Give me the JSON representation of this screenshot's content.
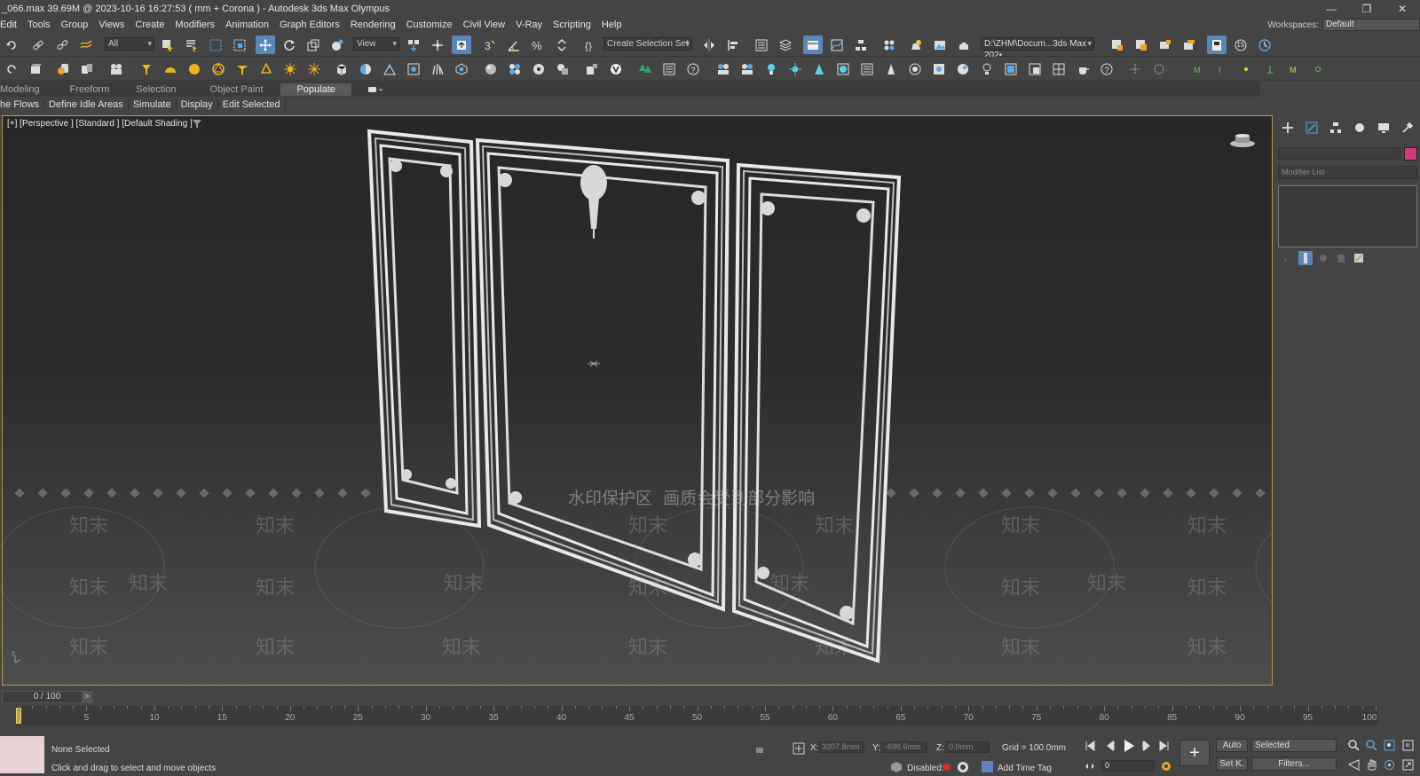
{
  "titlebar": {
    "title": "_066.max  39.69M @ 2023-10-16 16:27:53  ( mm + Corona ) - Autodesk 3ds Max Olympus",
    "minimize": "—",
    "restore": "❐",
    "close": "✕"
  },
  "menu": [
    "Edit",
    "Tools",
    "Group",
    "Views",
    "Create",
    "Modifiers",
    "Animation",
    "Graph Editors",
    "Rendering",
    "Customize",
    "Civil View",
    "V-Ray",
    "Scripting",
    "Help"
  ],
  "workspaces": {
    "label": "Workspaces:",
    "value": "Default"
  },
  "toolbar1": {
    "filter": "All",
    "refcoord": "View",
    "selection_set": "Create Selection Set",
    "project_path": "D:\\ZHM\\Docum...3ds Max 202•",
    "badge": "15"
  },
  "ribbon": {
    "tabs": [
      "Modeling",
      "Freeform",
      "Selection",
      "Object Paint",
      "Populate"
    ],
    "active_tab": "Populate",
    "sub": [
      "he Flows",
      "Define Idle Areas",
      "Simulate",
      "Display",
      "Edit Selected"
    ]
  },
  "viewport": {
    "label": "[+] [Perspective ] [Standard ] [Default Shading ]",
    "watermark_banner": "水印保护区  画质会受到部分影响",
    "watermark_text": "知末"
  },
  "command_panel": {
    "modifier_list": "Modifier List",
    "object_color": "#d23a7d"
  },
  "timeline": {
    "frame_display": "0 / 100",
    "ticks": [
      "5",
      "10",
      "15",
      "20",
      "25",
      "30",
      "35",
      "40",
      "45",
      "50",
      "55",
      "60",
      "65",
      "70",
      "75",
      "80",
      "85",
      "90",
      "95",
      "100"
    ]
  },
  "status": {
    "selection": "None Selected",
    "prompt": "Click and drag to select and move objects",
    "x_label": "X:",
    "x_value": "3207.8mm",
    "y_label": "Y:",
    "y_value": "-696.6mm",
    "z_label": "Z:",
    "z_value": "0.0mm",
    "grid": "Grid = 100.0mm",
    "disabled": "Disabled:",
    "add_time_tag": "Add Time Tag",
    "auto": "Auto",
    "selected": "Selected",
    "set_key": "Set K.",
    "filters": "Filters...",
    "frame_field": "0"
  }
}
